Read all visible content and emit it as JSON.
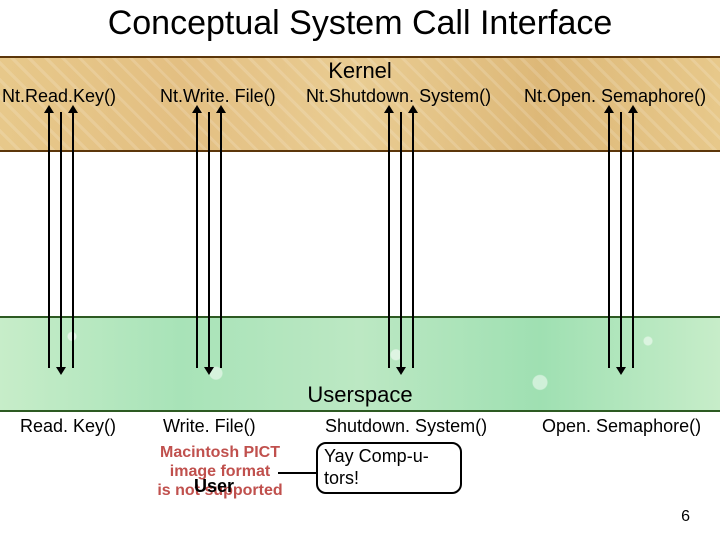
{
  "title": "Conceptual System Call Interface",
  "kernel": {
    "title": "Kernel",
    "apis": [
      "Nt.Read.Key()",
      "Nt.Write. File()",
      "Nt.Shutdown. System()",
      "Nt.Open. Semaphore()"
    ]
  },
  "userspace": {
    "title": "Userspace",
    "apis": [
      "Read. Key()",
      "Write. File()",
      "Shutdown. System()",
      "Open. Semaphore()"
    ]
  },
  "pict_placeholder": {
    "line1": "Macintosh PICT",
    "line2": "image format",
    "line3": "is not supported"
  },
  "user_label": "User",
  "speech": "Yay Comp-u-tors!",
  "slide_number": "6",
  "chart_data": {
    "type": "diagram",
    "title": "Conceptual System Call Interface",
    "layers": [
      {
        "name": "Kernel",
        "functions": [
          "Nt.Read.Key()",
          "Nt.Write.File()",
          "Nt.Shutdown.System()",
          "Nt.Open.Semaphore()"
        ]
      },
      {
        "name": "Userspace",
        "functions": [
          "Read.Key()",
          "Write.File()",
          "Shutdown.System()",
          "Open.Semaphore()"
        ]
      }
    ],
    "mappings": [
      {
        "user": "Read.Key()",
        "kernel": "Nt.Read.Key()"
      },
      {
        "user": "Write.File()",
        "kernel": "Nt.Write.File()"
      },
      {
        "user": "Shutdown.System()",
        "kernel": "Nt.Shutdown.System()"
      },
      {
        "user": "Open.Semaphore()",
        "kernel": "Nt.Open.Semaphore()"
      }
    ],
    "actor": {
      "label": "User",
      "says": "Yay Comp-u-tors!"
    },
    "slide": 6
  }
}
